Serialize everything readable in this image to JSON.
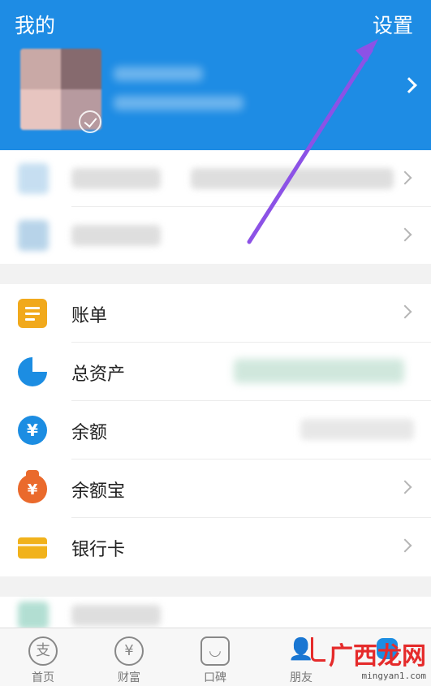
{
  "header": {
    "title": "我的",
    "settings_label": "设置",
    "bg_color": "#1e8ce4"
  },
  "profile_menu": {
    "items": [
      {
        "label": "蚂蚁",
        "detail": "提"
      },
      {
        "label": "商家服务"
      }
    ]
  },
  "main_menu": {
    "items": [
      {
        "label": "账单",
        "icon": "bill-icon"
      },
      {
        "label": "总资产",
        "icon": "pie-chart-icon",
        "detail": "账户"
      },
      {
        "label": "余额",
        "icon": "yuan-icon"
      },
      {
        "label": "余额宝",
        "icon": "money-bag-icon"
      },
      {
        "label": "银行卡",
        "icon": "bank-card-icon"
      }
    ]
  },
  "tabbar": {
    "tabs": [
      {
        "label": "首页",
        "icon": "alipay-icon",
        "glyph": "支"
      },
      {
        "label": "财富",
        "icon": "yuan-icon",
        "glyph": "¥"
      },
      {
        "label": "口碑",
        "icon": "koubei-icon",
        "glyph": "◡"
      },
      {
        "label": "朋友",
        "icon": "friends-icon",
        "glyph": "👤"
      },
      {
        "label": "",
        "icon": "me-icon",
        "glyph": ""
      }
    ]
  },
  "watermark": {
    "main": "广西龙网",
    "sub": "mingyan1.com"
  },
  "annotation": {
    "arrow_color": "#8c52e6"
  }
}
